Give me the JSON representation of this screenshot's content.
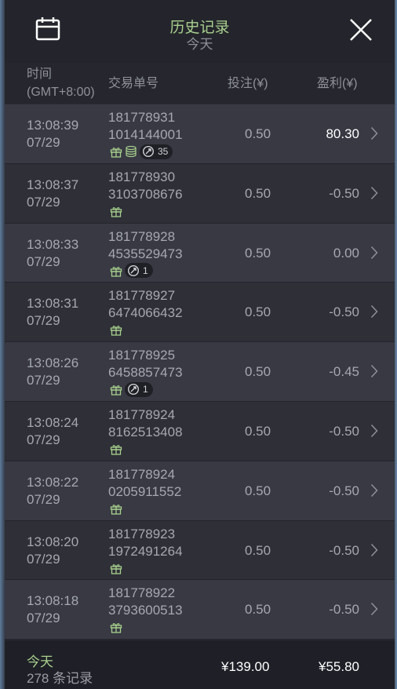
{
  "header": {
    "title": "历史记录",
    "subtitle": "今天"
  },
  "columns": {
    "time_line1": "时间",
    "time_line2": "(GMT+8:00)",
    "order_id": "交易单号",
    "bet": "投注(¥)",
    "profit": "盈利(¥)"
  },
  "rows": [
    {
      "time": "13:08:39",
      "date": "07/29",
      "id1": "181778931",
      "id2": "1014144001",
      "bet": "0.50",
      "profit": "80.30",
      "win": true,
      "icons": [
        "gift-icon",
        "coins-icon"
      ],
      "pill": "35"
    },
    {
      "time": "13:08:37",
      "date": "07/29",
      "id1": "181778930",
      "id2": "3103708676",
      "bet": "0.50",
      "profit": "-0.50",
      "win": false,
      "icons": [
        "gift-icon"
      ],
      "pill": null
    },
    {
      "time": "13:08:33",
      "date": "07/29",
      "id1": "181778928",
      "id2": "4535529473",
      "bet": "0.50",
      "profit": "0.00",
      "win": false,
      "icons": [
        "gift-icon"
      ],
      "pill": "1"
    },
    {
      "time": "13:08:31",
      "date": "07/29",
      "id1": "181778927",
      "id2": "6474066432",
      "bet": "0.50",
      "profit": "-0.50",
      "win": false,
      "icons": [
        "gift-icon"
      ],
      "pill": null
    },
    {
      "time": "13:08:26",
      "date": "07/29",
      "id1": "181778925",
      "id2": "6458857473",
      "bet": "0.50",
      "profit": "-0.45",
      "win": false,
      "icons": [
        "gift-icon"
      ],
      "pill": "1"
    },
    {
      "time": "13:08:24",
      "date": "07/29",
      "id1": "181778924",
      "id2": "8162513408",
      "bet": "0.50",
      "profit": "-0.50",
      "win": false,
      "icons": [
        "gift-icon"
      ],
      "pill": null
    },
    {
      "time": "13:08:22",
      "date": "07/29",
      "id1": "181778924",
      "id2": "0205911552",
      "bet": "0.50",
      "profit": "-0.50",
      "win": false,
      "icons": [
        "gift-icon"
      ],
      "pill": null
    },
    {
      "time": "13:08:20",
      "date": "07/29",
      "id1": "181778923",
      "id2": "1972491264",
      "bet": "0.50",
      "profit": "-0.50",
      "win": false,
      "icons": [
        "gift-icon"
      ],
      "pill": null
    },
    {
      "time": "13:08:18",
      "date": "07/29",
      "id1": "181778922",
      "id2": "3793600513",
      "bet": "0.50",
      "profit": "-0.50",
      "win": false,
      "icons": [
        "gift-icon"
      ],
      "pill": null
    }
  ],
  "footer": {
    "today": "今天",
    "count": "278 条记录",
    "total_bet": "¥139.00",
    "total_profit": "¥55.80"
  },
  "colors": {
    "accent_green": "#a8d08d",
    "panel_bg": "#2a2b33",
    "row_odd": "#383943",
    "row_even": "#2e2f37"
  }
}
